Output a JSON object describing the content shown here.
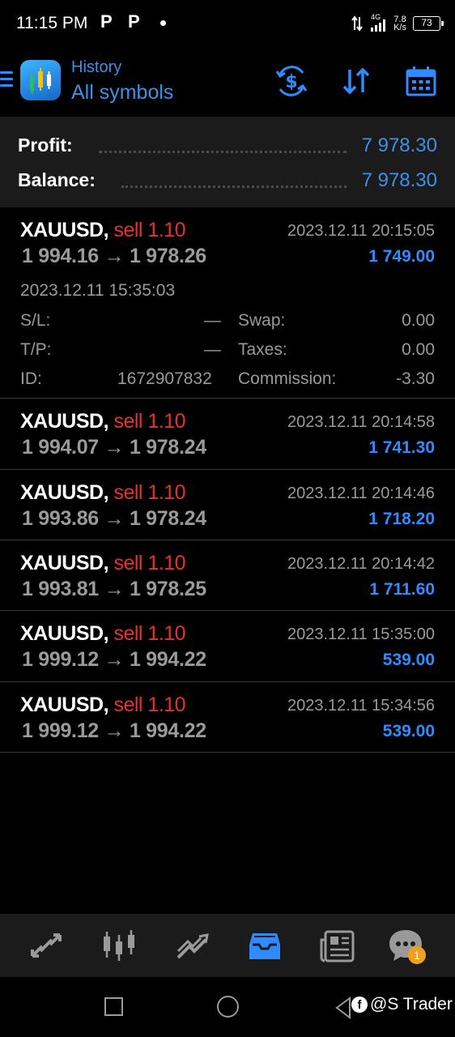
{
  "status_bar": {
    "time": "11:15 PM",
    "notif_icons": [
      "P",
      "P"
    ],
    "network_type": "4G",
    "speed_value": "7.8",
    "speed_unit": "K/s",
    "battery": "73"
  },
  "header": {
    "subtitle": "History",
    "title": "All symbols",
    "icons": [
      "menu-icon",
      "app-logo",
      "deposit-icon",
      "sort-icon",
      "calendar-icon"
    ],
    "accent_color": "#3d8fe8"
  },
  "summary": {
    "profit_label": "Profit:",
    "profit_value": "7 978.30",
    "balance_label": "Balance:",
    "balance_value": "7 978.30"
  },
  "trades": [
    {
      "symbol": "XAUUSD,",
      "side": "sell 1.10",
      "open_price": "1 994.16",
      "arrow": "→",
      "close_price": "1 978.26",
      "close_time": "2023.12.11 20:15:05",
      "profit": "1 749.00",
      "open_time": "2023.12.11 15:35:03",
      "sl_label": "S/L:",
      "sl_value": "—",
      "tp_label": "T/P:",
      "tp_value": "—",
      "id_label": "ID:",
      "id_value": "1672907832",
      "swap_label": "Swap:",
      "swap_value": "0.00",
      "taxes_label": "Taxes:",
      "taxes_value": "0.00",
      "commission_label": "Commission:",
      "commission_value": "-3.30"
    },
    {
      "symbol": "XAUUSD,",
      "side": "sell 1.10",
      "open_price": "1 994.07",
      "arrow": "→",
      "close_price": "1 978.24",
      "close_time": "2023.12.11 20:14:58",
      "profit": "1 741.30"
    },
    {
      "symbol": "XAUUSD,",
      "side": "sell 1.10",
      "open_price": "1 993.86",
      "arrow": "→",
      "close_price": "1 978.24",
      "close_time": "2023.12.11 20:14:46",
      "profit": "1 718.20"
    },
    {
      "symbol": "XAUUSD,",
      "side": "sell 1.10",
      "open_price": "1 993.81",
      "arrow": "→",
      "close_price": "1 978.25",
      "close_time": "2023.12.11 20:14:42",
      "profit": "1 711.60"
    },
    {
      "symbol": "XAUUSD,",
      "side": "sell 1.10",
      "open_price": "1 999.12",
      "arrow": "→",
      "close_price": "1 994.22",
      "close_time": "2023.12.11 15:35:00",
      "profit": "539.00"
    },
    {
      "symbol": "XAUUSD,",
      "side": "sell 1.10",
      "open_price": "1 999.12",
      "arrow": "→",
      "close_price": "1 994.22",
      "close_time": "2023.12.11 15:34:56",
      "profit": "539.00"
    }
  ],
  "bottom_nav": {
    "items": [
      "quotes-icon",
      "chart-icon",
      "trade-icon",
      "history-icon",
      "news-icon",
      "chat-icon"
    ],
    "active": "history-icon",
    "chat_badge": "1"
  },
  "watermark": "@S Trader",
  "colors": {
    "sell": "#e5322e",
    "profit": "#2f8bff",
    "muted": "#9a9a9a"
  }
}
